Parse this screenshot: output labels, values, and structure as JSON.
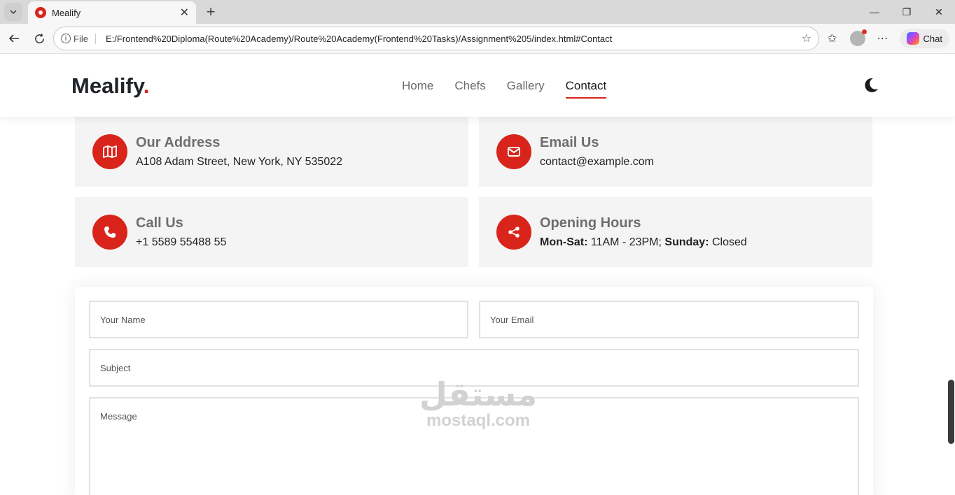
{
  "browser": {
    "tab_title": "Mealify",
    "url_scheme_label": "File",
    "url": "E:/Frontend%20Diploma(Route%20Academy)/Route%20Academy(Frontend%20Tasks)/Assignment%205/index.html#Contact",
    "chat_label": "Chat"
  },
  "site": {
    "logo_text": "Mealify",
    "logo_dot": ".",
    "nav": [
      {
        "label": "Home"
      },
      {
        "label": "Chefs"
      },
      {
        "label": "Gallery"
      },
      {
        "label": "Contact"
      }
    ],
    "accent_color": "#d9241b"
  },
  "contact_cards": {
    "address": {
      "title": "Our Address",
      "text": "A108 Adam Street, New York, NY 535022",
      "icon": "map-icon"
    },
    "email": {
      "title": "Email Us",
      "text": "contact@example.com",
      "icon": "envelope-icon"
    },
    "phone": {
      "title": "Call Us",
      "text": "+1 5589 55488 55",
      "icon": "phone-icon"
    },
    "hours": {
      "title": "Opening Hours",
      "weekday_label": "Mon-Sat:",
      "weekday_hours": " 11AM - 23PM; ",
      "sunday_label": "Sunday:",
      "sunday_hours": " Closed",
      "icon": "share-icon"
    }
  },
  "form": {
    "name_placeholder": "Your Name",
    "email_placeholder": "Your Email",
    "subject_placeholder": "Subject",
    "message_placeholder": "Message"
  },
  "watermark": {
    "arabic": "مستقل",
    "latin": "mostaql.com"
  }
}
